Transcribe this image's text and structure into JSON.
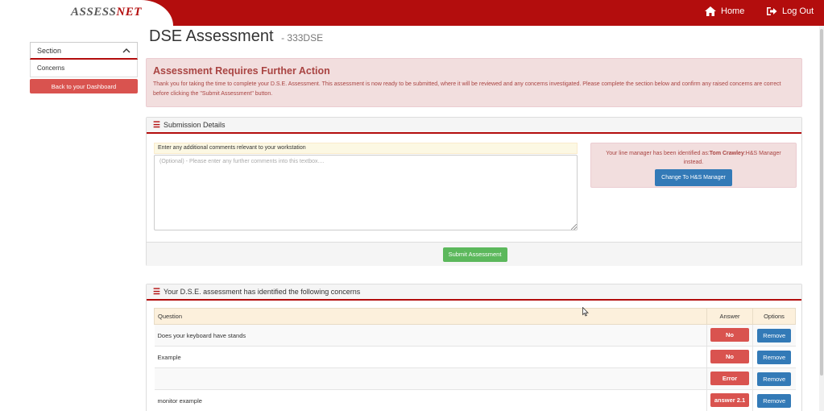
{
  "header": {
    "logo_assess": "ASSESS",
    "logo_net": "NET",
    "home_label": "Home",
    "logout_label": "Log Out",
    "bar_color": "#b30d0d"
  },
  "sidebar": {
    "section_label": "Section",
    "items": [
      {
        "label": "Concerns"
      }
    ],
    "dashboard_button": "Back to your Dashboard"
  },
  "page": {
    "title": "DSE Assessment",
    "code": "- 333DSE"
  },
  "alert": {
    "title": "Assessment Requires Further Action",
    "text": "Thank you for taking the time to complete your D.S.E. Assessment. This assessment is now ready to be submitted, where it will be reviewed and any concerns investigated. Please complete the section below and confirm any raised concerns are correct before clicking the \"Submit Assessment\" button."
  },
  "submission": {
    "heading": "Submission Details",
    "comment_label": "Enter any additional comments relevant to your workstation",
    "comment_value": "",
    "comment_placeholder": "(Optional) - Please enter any further comments into this textbox....",
    "manager_prefix": "Your line manager has been identified as:",
    "manager_name": "Tom Crawley",
    "manager_suffix": ":H&S Manager",
    "manager_tail": "instead.",
    "change_button": "Change To H&S Manager",
    "submit_button": "Submit Assessment"
  },
  "concerns": {
    "heading": "Your D.S.E. assessment has identified the following concerns",
    "columns": {
      "question": "Question",
      "answer": "Answer",
      "options": "Options"
    },
    "rows": [
      {
        "question": "Does your keyboard have stands",
        "answer": "No",
        "option": "Remove"
      },
      {
        "question": "Example",
        "answer": "No",
        "option": "Remove"
      },
      {
        "question": "",
        "answer": "Error",
        "option": "Remove"
      },
      {
        "question": "monitor example",
        "answer": "answer 2.1",
        "option": "Remove"
      }
    ]
  }
}
